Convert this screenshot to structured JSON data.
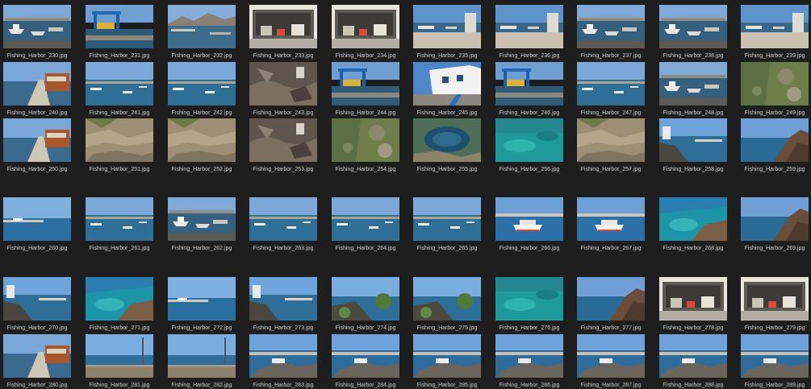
{
  "gallery": {
    "items": [
      {
        "filename": "Fishing_Harbor_230.jpg",
        "thumb": "harbor-boats"
      },
      {
        "filename": "Fishing_Harbor_231.jpg",
        "thumb": "harbor-crane"
      },
      {
        "filename": "Fishing_Harbor_232.jpg",
        "thumb": "harbor-mountains"
      },
      {
        "filename": "Fishing_Harbor_233.jpg",
        "thumb": "warehouse"
      },
      {
        "filename": "Fishing_Harbor_234.jpg",
        "thumb": "warehouse"
      },
      {
        "filename": "Fishing_Harbor_235.jpg",
        "thumb": "harbor-quay"
      },
      {
        "filename": "Fishing_Harbor_236.jpg",
        "thumb": "harbor-quay"
      },
      {
        "filename": "Fishing_Harbor_237.jpg",
        "thumb": "harbor-boats"
      },
      {
        "filename": "Fishing_Harbor_238.jpg",
        "thumb": "harbor-boats"
      },
      {
        "filename": "Fishing_Harbor_239.jpg",
        "thumb": "harbor-quay"
      },
      {
        "filename": "Fishing_Harbor_240.jpg",
        "thumb": "promenade"
      },
      {
        "filename": "Fishing_Harbor_241.jpg",
        "thumb": "harbor-water"
      },
      {
        "filename": "Fishing_Harbor_242.jpg",
        "thumb": "harbor-water"
      },
      {
        "filename": "Fishing_Harbor_243.jpg",
        "thumb": "rocks"
      },
      {
        "filename": "Fishing_Harbor_244.jpg",
        "thumb": "harbor-crane"
      },
      {
        "filename": "Fishing_Harbor_245.jpg",
        "thumb": "white-building"
      },
      {
        "filename": "Fishing_Harbor_246.jpg",
        "thumb": "harbor-crane"
      },
      {
        "filename": "Fishing_Harbor_247.jpg",
        "thumb": "harbor-water"
      },
      {
        "filename": "Fishing_Harbor_248.jpg",
        "thumb": "harbor-boats"
      },
      {
        "filename": "Fishing_Harbor_249.jpg",
        "thumb": "green-rocks"
      },
      {
        "filename": "Fishing_Harbor_250.jpg",
        "thumb": "promenade"
      },
      {
        "filename": "Fishing_Harbor_251.jpg",
        "thumb": "rock-closeup"
      },
      {
        "filename": "Fishing_Harbor_252.jpg",
        "thumb": "rock-closeup"
      },
      {
        "filename": "Fishing_Harbor_253.jpg",
        "thumb": "rocks"
      },
      {
        "filename": "Fishing_Harbor_254.jpg",
        "thumb": "green-rocks"
      },
      {
        "filename": "Fishing_Harbor_255.jpg",
        "thumb": "tidepool"
      },
      {
        "filename": "Fishing_Harbor_256.jpg",
        "thumb": "turquoise-water"
      },
      {
        "filename": "Fishing_Harbor_257.jpg",
        "thumb": "rock-closeup"
      },
      {
        "filename": "Fishing_Harbor_258.jpg",
        "thumb": "coast-view"
      },
      {
        "filename": "Fishing_Harbor_259.jpg",
        "thumb": "sea-cliff"
      },
      {
        "filename": "Fishing_Harbor_260.jpg",
        "thumb": "open-sea"
      },
      {
        "filename": "Fishing_Harbor_261.jpg",
        "thumb": "harbor-water"
      },
      {
        "filename": "Fishing_Harbor_262.jpg",
        "thumb": "harbor-boats"
      },
      {
        "filename": "Fishing_Harbor_263.jpg",
        "thumb": "harbor-water"
      },
      {
        "filename": "Fishing_Harbor_264.jpg",
        "thumb": "harbor-water"
      },
      {
        "filename": "Fishing_Harbor_265.jpg",
        "thumb": "harbor-water"
      },
      {
        "filename": "Fishing_Harbor_266.jpg",
        "thumb": "ferry"
      },
      {
        "filename": "Fishing_Harbor_267.jpg",
        "thumb": "ferry"
      },
      {
        "filename": "Fishing_Harbor_268.jpg",
        "thumb": "turquoise-coast"
      },
      {
        "filename": "Fishing_Harbor_269.jpg",
        "thumb": "sea-cliff"
      },
      {
        "filename": "Fishing_Harbor_270.jpg",
        "thumb": "coast-view"
      },
      {
        "filename": "Fishing_Harbor_271.jpg",
        "thumb": "turquoise-coast"
      },
      {
        "filename": "Fishing_Harbor_272.jpg",
        "thumb": "open-sea"
      },
      {
        "filename": "Fishing_Harbor_273.jpg",
        "thumb": "coast-view"
      },
      {
        "filename": "Fishing_Harbor_274.jpg",
        "thumb": "coast-plants"
      },
      {
        "filename": "Fishing_Harbor_275.jpg",
        "thumb": "coast-plants"
      },
      {
        "filename": "Fishing_Harbor_276.jpg",
        "thumb": "turquoise-water"
      },
      {
        "filename": "Fishing_Harbor_277.jpg",
        "thumb": "sea-cliff"
      },
      {
        "filename": "Fishing_Harbor_278.jpg",
        "thumb": "warehouse"
      },
      {
        "filename": "Fishing_Harbor_279.jpg",
        "thumb": "warehouse"
      },
      {
        "filename": "Fishing_Harbor_280.jpg",
        "thumb": "promenade"
      },
      {
        "filename": "Fishing_Harbor_281.jpg",
        "thumb": "sea-wall"
      },
      {
        "filename": "Fishing_Harbor_282.jpg",
        "thumb": "sea-wall"
      },
      {
        "filename": "Fishing_Harbor_283.jpg",
        "thumb": "pier-sea"
      },
      {
        "filename": "Fishing_Harbor_284.jpg",
        "thumb": "pier-sea"
      },
      {
        "filename": "Fishing_Harbor_285.jpg",
        "thumb": "pier-sea"
      },
      {
        "filename": "Fishing_Harbor_286.jpg",
        "thumb": "pier-sea"
      },
      {
        "filename": "Fishing_Harbor_287.jpg",
        "thumb": "pier-sea"
      },
      {
        "filename": "Fishing_Harbor_288.jpg",
        "thumb": "pier-sea"
      },
      {
        "filename": "Fishing_Harbor_289.jpg",
        "thumb": "pier-sea"
      }
    ]
  },
  "colors": {
    "background": "#1e1e1e",
    "caption_text": "#d0d0d0"
  }
}
